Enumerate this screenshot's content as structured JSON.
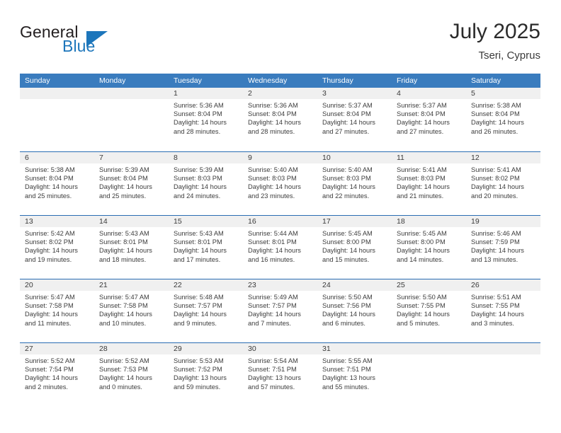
{
  "brand": {
    "word1": "General",
    "word2": "Blue",
    "triangle_color": "#1d76bb"
  },
  "header": {
    "title": "July 2025",
    "location": "Tseri, Cyprus"
  },
  "colors": {
    "header_blue": "#3a7cbe",
    "row_divider_blue": "#2a6db3",
    "date_strip_gray": "#f0f0f0"
  },
  "weekday_headers": [
    "Sunday",
    "Monday",
    "Tuesday",
    "Wednesday",
    "Thursday",
    "Friday",
    "Saturday"
  ],
  "weeks": [
    [
      {
        "day": "",
        "lines": []
      },
      {
        "day": "",
        "lines": []
      },
      {
        "day": "1",
        "lines": [
          "Sunrise: 5:36 AM",
          "Sunset: 8:04 PM",
          "Daylight: 14 hours",
          "and 28 minutes."
        ]
      },
      {
        "day": "2",
        "lines": [
          "Sunrise: 5:36 AM",
          "Sunset: 8:04 PM",
          "Daylight: 14 hours",
          "and 28 minutes."
        ]
      },
      {
        "day": "3",
        "lines": [
          "Sunrise: 5:37 AM",
          "Sunset: 8:04 PM",
          "Daylight: 14 hours",
          "and 27 minutes."
        ]
      },
      {
        "day": "4",
        "lines": [
          "Sunrise: 5:37 AM",
          "Sunset: 8:04 PM",
          "Daylight: 14 hours",
          "and 27 minutes."
        ]
      },
      {
        "day": "5",
        "lines": [
          "Sunrise: 5:38 AM",
          "Sunset: 8:04 PM",
          "Daylight: 14 hours",
          "and 26 minutes."
        ]
      }
    ],
    [
      {
        "day": "6",
        "lines": [
          "Sunrise: 5:38 AM",
          "Sunset: 8:04 PM",
          "Daylight: 14 hours",
          "and 25 minutes."
        ]
      },
      {
        "day": "7",
        "lines": [
          "Sunrise: 5:39 AM",
          "Sunset: 8:04 PM",
          "Daylight: 14 hours",
          "and 25 minutes."
        ]
      },
      {
        "day": "8",
        "lines": [
          "Sunrise: 5:39 AM",
          "Sunset: 8:03 PM",
          "Daylight: 14 hours",
          "and 24 minutes."
        ]
      },
      {
        "day": "9",
        "lines": [
          "Sunrise: 5:40 AM",
          "Sunset: 8:03 PM",
          "Daylight: 14 hours",
          "and 23 minutes."
        ]
      },
      {
        "day": "10",
        "lines": [
          "Sunrise: 5:40 AM",
          "Sunset: 8:03 PM",
          "Daylight: 14 hours",
          "and 22 minutes."
        ]
      },
      {
        "day": "11",
        "lines": [
          "Sunrise: 5:41 AM",
          "Sunset: 8:03 PM",
          "Daylight: 14 hours",
          "and 21 minutes."
        ]
      },
      {
        "day": "12",
        "lines": [
          "Sunrise: 5:41 AM",
          "Sunset: 8:02 PM",
          "Daylight: 14 hours",
          "and 20 minutes."
        ]
      }
    ],
    [
      {
        "day": "13",
        "lines": [
          "Sunrise: 5:42 AM",
          "Sunset: 8:02 PM",
          "Daylight: 14 hours",
          "and 19 minutes."
        ]
      },
      {
        "day": "14",
        "lines": [
          "Sunrise: 5:43 AM",
          "Sunset: 8:01 PM",
          "Daylight: 14 hours",
          "and 18 minutes."
        ]
      },
      {
        "day": "15",
        "lines": [
          "Sunrise: 5:43 AM",
          "Sunset: 8:01 PM",
          "Daylight: 14 hours",
          "and 17 minutes."
        ]
      },
      {
        "day": "16",
        "lines": [
          "Sunrise: 5:44 AM",
          "Sunset: 8:01 PM",
          "Daylight: 14 hours",
          "and 16 minutes."
        ]
      },
      {
        "day": "17",
        "lines": [
          "Sunrise: 5:45 AM",
          "Sunset: 8:00 PM",
          "Daylight: 14 hours",
          "and 15 minutes."
        ]
      },
      {
        "day": "18",
        "lines": [
          "Sunrise: 5:45 AM",
          "Sunset: 8:00 PM",
          "Daylight: 14 hours",
          "and 14 minutes."
        ]
      },
      {
        "day": "19",
        "lines": [
          "Sunrise: 5:46 AM",
          "Sunset: 7:59 PM",
          "Daylight: 14 hours",
          "and 13 minutes."
        ]
      }
    ],
    [
      {
        "day": "20",
        "lines": [
          "Sunrise: 5:47 AM",
          "Sunset: 7:58 PM",
          "Daylight: 14 hours",
          "and 11 minutes."
        ]
      },
      {
        "day": "21",
        "lines": [
          "Sunrise: 5:47 AM",
          "Sunset: 7:58 PM",
          "Daylight: 14 hours",
          "and 10 minutes."
        ]
      },
      {
        "day": "22",
        "lines": [
          "Sunrise: 5:48 AM",
          "Sunset: 7:57 PM",
          "Daylight: 14 hours",
          "and 9 minutes."
        ]
      },
      {
        "day": "23",
        "lines": [
          "Sunrise: 5:49 AM",
          "Sunset: 7:57 PM",
          "Daylight: 14 hours",
          "and 7 minutes."
        ]
      },
      {
        "day": "24",
        "lines": [
          "Sunrise: 5:50 AM",
          "Sunset: 7:56 PM",
          "Daylight: 14 hours",
          "and 6 minutes."
        ]
      },
      {
        "day": "25",
        "lines": [
          "Sunrise: 5:50 AM",
          "Sunset: 7:55 PM",
          "Daylight: 14 hours",
          "and 5 minutes."
        ]
      },
      {
        "day": "26",
        "lines": [
          "Sunrise: 5:51 AM",
          "Sunset: 7:55 PM",
          "Daylight: 14 hours",
          "and 3 minutes."
        ]
      }
    ],
    [
      {
        "day": "27",
        "lines": [
          "Sunrise: 5:52 AM",
          "Sunset: 7:54 PM",
          "Daylight: 14 hours",
          "and 2 minutes."
        ]
      },
      {
        "day": "28",
        "lines": [
          "Sunrise: 5:52 AM",
          "Sunset: 7:53 PM",
          "Daylight: 14 hours",
          "and 0 minutes."
        ]
      },
      {
        "day": "29",
        "lines": [
          "Sunrise: 5:53 AM",
          "Sunset: 7:52 PM",
          "Daylight: 13 hours",
          "and 59 minutes."
        ]
      },
      {
        "day": "30",
        "lines": [
          "Sunrise: 5:54 AM",
          "Sunset: 7:51 PM",
          "Daylight: 13 hours",
          "and 57 minutes."
        ]
      },
      {
        "day": "31",
        "lines": [
          "Sunrise: 5:55 AM",
          "Sunset: 7:51 PM",
          "Daylight: 13 hours",
          "and 55 minutes."
        ]
      },
      {
        "day": "",
        "lines": []
      },
      {
        "day": "",
        "lines": []
      }
    ]
  ]
}
